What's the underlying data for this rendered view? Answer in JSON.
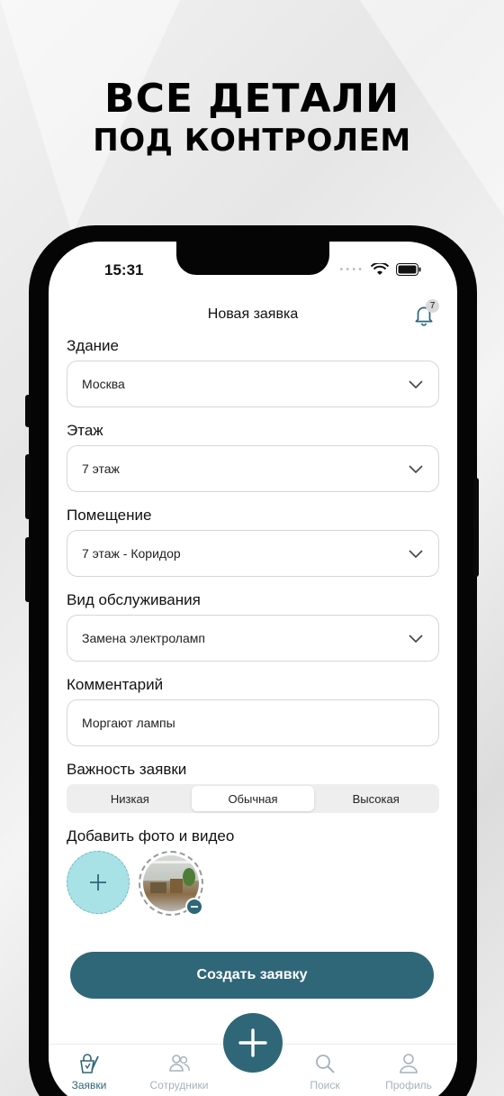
{
  "headline": {
    "line1": "ВСЕ ДЕТАЛИ",
    "line2": "ПОД КОНТРОЛЕМ"
  },
  "status_bar": {
    "time": "15:31"
  },
  "nav": {
    "title": "Новая заявка",
    "notification_count": "7"
  },
  "form": {
    "building": {
      "label": "Здание",
      "value": "Москва"
    },
    "floor": {
      "label": "Этаж",
      "value": "7 этаж"
    },
    "room": {
      "label": "Помещение",
      "value": "7 этаж - Коридор"
    },
    "service": {
      "label": "Вид обслуживания",
      "value": "Замена электроламп"
    },
    "comment": {
      "label": "Комментарий",
      "value": "Моргают лампы"
    },
    "priority": {
      "label": "Важность заявки",
      "options": [
        "Низкая",
        "Обычная",
        "Высокая"
      ],
      "selected": "Обычная"
    },
    "media": {
      "label": "Добавить фото и видео"
    }
  },
  "create_button": "Создать заявку",
  "tabbar": {
    "tabs": [
      {
        "label": "Заявки",
        "icon": "requests-icon",
        "active": true
      },
      {
        "label": "Сотрудники",
        "icon": "employees-icon",
        "active": false
      },
      {
        "label": "Поиск",
        "icon": "search-icon",
        "active": false
      },
      {
        "label": "Профиль",
        "icon": "profile-icon",
        "active": false
      }
    ]
  },
  "colors": {
    "accent": "#2f6778",
    "add_photo_bg": "#a8e1e6",
    "inactive_tab": "#a3b4bb"
  }
}
